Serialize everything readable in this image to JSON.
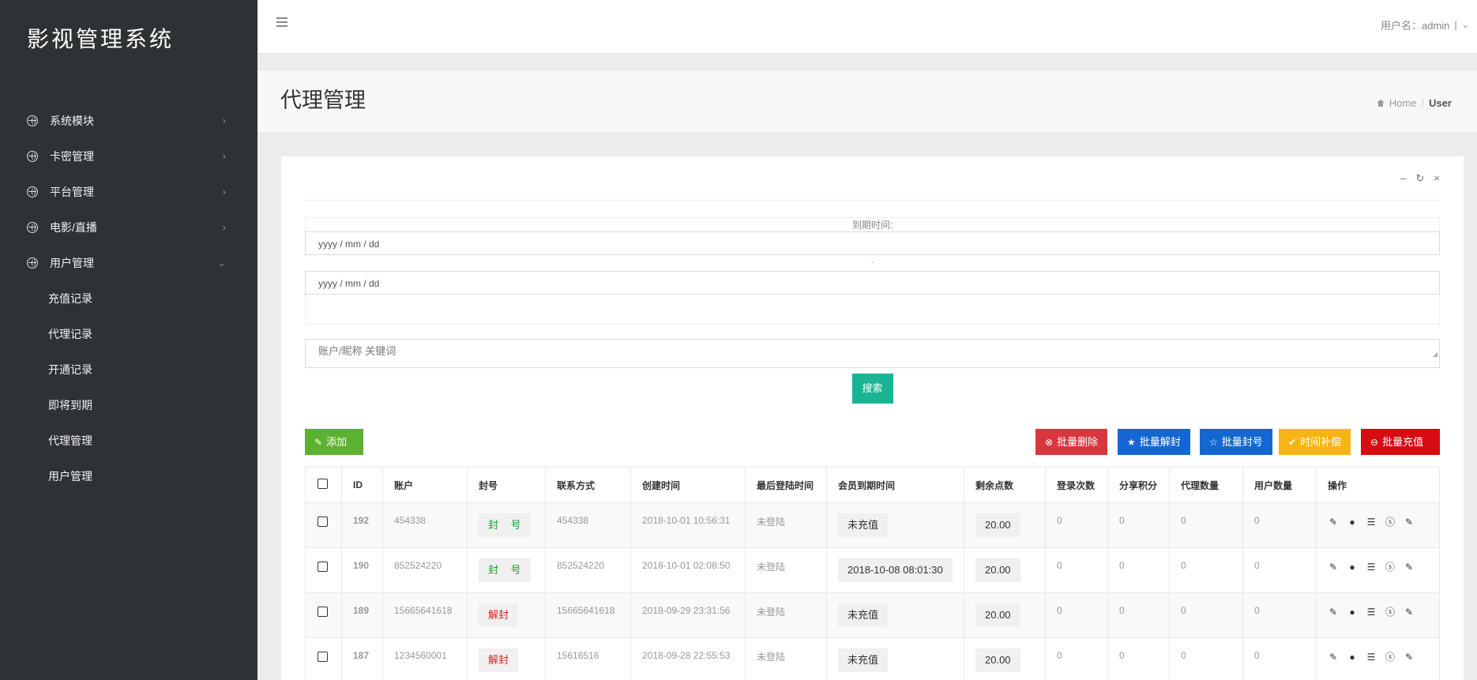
{
  "app": {
    "brand": "影视管理系统"
  },
  "sidebar": {
    "items": [
      {
        "label": "系统模块",
        "arrow": "›"
      },
      {
        "label": "卡密管理",
        "arrow": "›"
      },
      {
        "label": "平台管理",
        "arrow": "›"
      },
      {
        "label": "电影/直播",
        "arrow": "›"
      },
      {
        "label": "用户管理",
        "arrow": "⌄"
      }
    ],
    "subitems": [
      "充值记录",
      "代理记录",
      "开通记录",
      "即将到期",
      "代理管理",
      "用户管理"
    ]
  },
  "topbar": {
    "user_label": "用户名：admin",
    "separator": "|",
    "caret": "⌄"
  },
  "page": {
    "title": "代理管理"
  },
  "breadcrumb": {
    "home": "Home",
    "separator": "/",
    "current": "User"
  },
  "panel": {
    "tools": {
      "minimize": "–",
      "refresh": "↻",
      "close": "×"
    }
  },
  "filter": {
    "label": "到期时间:",
    "date_placeholder_start": "yyyy / mm / dd",
    "dash": "-",
    "date_placeholder_end": "yyyy / mm / dd",
    "keyword_placeholder": "账户/昵称 关键词",
    "search_label": "搜索"
  },
  "actions": {
    "add": "添加",
    "batch_delete": "批量删除",
    "batch_unban": "批量解封",
    "batch_ban": "批量封号",
    "time_comp": "时间补偿",
    "batch_recharge": "批量充值"
  },
  "colors": {
    "add": "#5cb130",
    "batch_delete": "#d9363e",
    "batch_unban": "#1467d2",
    "batch_ban": "#1467d2",
    "time_comp": "#f7b515",
    "batch_recharge": "#d80a12",
    "search": "#1ab394"
  },
  "table": {
    "headers": [
      "ID",
      "账户",
      "封号",
      "联系方式",
      "创建时间",
      "最后登陆时间",
      "会员到期时间",
      "剩余点数",
      "登录次数",
      "分享积分",
      "代理数量",
      "用户数量",
      "操作"
    ],
    "rows": [
      {
        "id": "192",
        "account": "454338",
        "status": "封 号",
        "status_color": "green",
        "contact": "454338",
        "created": "2018-10-01 10:56:31",
        "last_login": "未登陆",
        "expire": "未充值",
        "points": "20.00",
        "logins": "0",
        "share": "0",
        "agents": "0",
        "users": "0"
      },
      {
        "id": "190",
        "account": "852524220",
        "status": "封 号",
        "status_color": "green",
        "contact": "852524220",
        "created": "2018-10-01 02:08:50",
        "last_login": "未登陆",
        "expire": "2018-10-08 08:01:30",
        "points": "20.00",
        "logins": "0",
        "share": "0",
        "agents": "0",
        "users": "0"
      },
      {
        "id": "189",
        "account": "15665641618",
        "status": "解封",
        "status_color": "red",
        "contact": "15665641618",
        "created": "2018-09-29 23:31:56",
        "last_login": "未登陆",
        "expire": "未充值",
        "points": "20.00",
        "logins": "0",
        "share": "0",
        "agents": "0",
        "users": "0"
      },
      {
        "id": "187",
        "account": "1234560001",
        "status": "解封",
        "status_color": "red",
        "contact": "15616516",
        "created": "2018-09-28 22:55:53",
        "last_login": "未登陆",
        "expire": "未充值",
        "points": "20.00",
        "logins": "0",
        "share": "0",
        "agents": "0",
        "users": "0"
      }
    ]
  }
}
